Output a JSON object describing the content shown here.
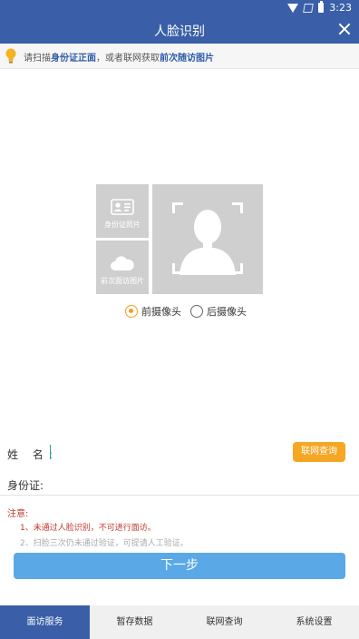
{
  "status_bar": {
    "time": "3:23"
  },
  "header": {
    "title": "人脸识别"
  },
  "tip": {
    "prefix": "请扫描",
    "highlight1": "身份证正面",
    "middle": "，或者联网获取",
    "highlight2": "前次随访图片"
  },
  "photos": {
    "id_card_label": "身份证照片",
    "prev_visit_label": "前次面访图片"
  },
  "camera": {
    "options": [
      {
        "label": "前摄像头",
        "selected": true
      },
      {
        "label": "后摄像头",
        "selected": false
      }
    ]
  },
  "form": {
    "name_label": "姓 名:",
    "name_value": "",
    "query_button": "联网查询",
    "id_label": "身份证:",
    "id_value": ""
  },
  "notice": {
    "title": "注意:",
    "items": [
      "1、未通过人脸识别，不可进行面访。",
      "2、扫脸三次仍未通过验证，可提请人工验证。"
    ]
  },
  "next_button": "下一步",
  "tabs": [
    {
      "label": "面访服务",
      "active": true
    },
    {
      "label": "暂存数据",
      "active": false
    },
    {
      "label": "联网查询",
      "active": false
    },
    {
      "label": "系统设置",
      "active": false
    }
  ],
  "colors": {
    "primary": "#3a5fa8",
    "accent": "#f5a623",
    "button": "#5aa9e6",
    "warning": "#c0392b"
  }
}
